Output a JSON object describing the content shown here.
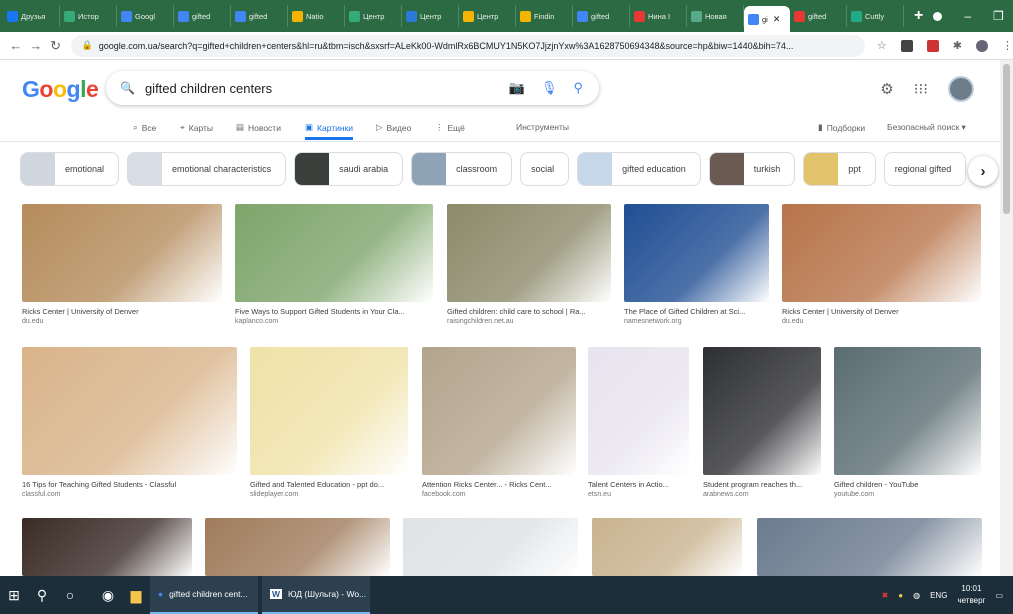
{
  "tabs": [
    {
      "label": "Друзья",
      "color": "#1877f2"
    },
    {
      "label": "Истор",
      "color": "#3a7"
    },
    {
      "label": "Googl",
      "color": "#4285f4"
    },
    {
      "label": "gifted",
      "color": "#4285f4"
    },
    {
      "label": "gifted",
      "color": "#4285f4"
    },
    {
      "label": "Natio",
      "color": "#f5b400"
    },
    {
      "label": "Центр",
      "color": "#3a7"
    },
    {
      "label": "Центр",
      "color": "#2d7ad6"
    },
    {
      "label": "Центр",
      "color": "#f5b400"
    },
    {
      "label": "Findin",
      "color": "#f5b400"
    },
    {
      "label": "gifted",
      "color": "#4285f4"
    },
    {
      "label": "Нина І",
      "color": "#e53935"
    },
    {
      "label": "Новая",
      "color": "#5a8"
    },
    {
      "label": "gi",
      "color": "#4285f4",
      "active": true
    },
    {
      "label": "gifted",
      "color": "#e53935"
    },
    {
      "label": "Cuttly",
      "color": "#2a8"
    }
  ],
  "address": {
    "url": "google.com.ua/search?q=gifted+children+centers&hl=ru&tbm=isch&sxsrf=ALeKk00-WdmlRx6BCMUY1N5KO7JjzjnYxw%3A1628750694348&source=hp&biw=1440&bih=74..."
  },
  "search": {
    "logo": "Google",
    "query": "gifted children centers"
  },
  "search_tabs": {
    "all": "Все",
    "maps": "Карты",
    "news": "Новости",
    "images": "Картинки",
    "video": "Видео",
    "more": "Ещё",
    "tools": "Инструменты",
    "collections": "Подборки",
    "safesearch": "Безопасный поиск ▾"
  },
  "chips": [
    {
      "label": "emotional",
      "color": "#cfd6df"
    },
    {
      "label": "emotional characteristics",
      "color": "#d6dde4"
    },
    {
      "label": "saudi arabia",
      "color": "#3b3f3c"
    },
    {
      "label": "classroom",
      "color": "#8fa3b6"
    },
    {
      "label": "social",
      "color": ""
    },
    {
      "label": "gifted education",
      "color": "#c7d7ea"
    },
    {
      "label": "turkish",
      "color": "#6b5a52"
    },
    {
      "label": "ppt",
      "color": "#e2c36b"
    },
    {
      "label": "regional gifted",
      "color": ""
    }
  ],
  "results_row1": [
    {
      "caption": "Ricks Center | University of Denver",
      "domain": "du.edu",
      "color": "#b58c5c"
    },
    {
      "caption": "Five Ways to Support Gifted Students in Your Cla...",
      "domain": "kaplanco.com",
      "color": "#7ea56b"
    },
    {
      "caption": "Gifted children: child care to school | Ra...",
      "domain": "raisingchildren.net.au",
      "color": "#8c8a6a"
    },
    {
      "caption": "The Place of Gifted Children at Sci...",
      "domain": "namesnetwork.org",
      "color": "#1f4e93"
    },
    {
      "caption": "Ricks Center | University of Denver",
      "domain": "du.edu",
      "color": "#b7744a"
    }
  ],
  "results_row2": [
    {
      "caption": "16 Tips for Teaching Gifted Students - Classful",
      "domain": "classful.com",
      "color": "#d9b48a"
    },
    {
      "caption": "Gifted and Talented Education - ppt do...",
      "domain": "slideplayer.com",
      "color": "#efe2a8"
    },
    {
      "caption": "Attention Ricks Center... - Ricks Cent...",
      "domain": "facebook.com",
      "color": "#b3a48c"
    },
    {
      "caption": "Talent Centers in Actio...",
      "domain": "etsn.eu",
      "color": "#e8e4ef"
    },
    {
      "caption": "Student program reaches th...",
      "domain": "arabnews.com",
      "color": "#2e2f33"
    },
    {
      "caption": "Gifted children - YouTube",
      "domain": "youtube.com",
      "color": "#5b6d72"
    }
  ],
  "results_row3": [
    {
      "color": "#3a2b26"
    },
    {
      "color": "#a07c5c"
    },
    {
      "color": "#dfe3e6"
    },
    {
      "color": "#c9b38f"
    },
    {
      "color": "#6c7b8f"
    }
  ],
  "taskbar": {
    "app1": "gifted children cent...",
    "app2": "ЮД (Шульга) - Wo...",
    "lang": "ENG",
    "time": "10:01",
    "day": "четверг"
  }
}
